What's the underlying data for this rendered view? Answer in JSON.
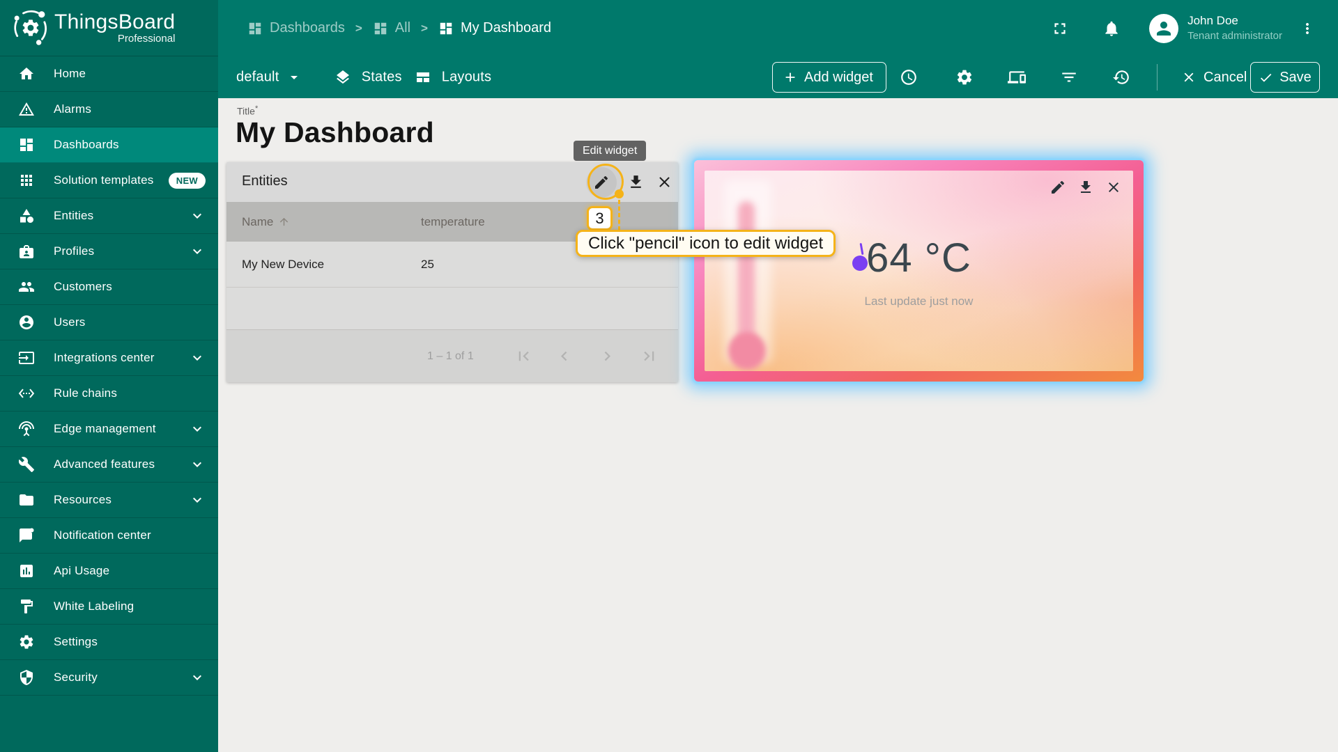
{
  "app": {
    "name": "ThingsBoard",
    "edition": "Professional"
  },
  "sidebar": {
    "items": [
      {
        "label": "Home",
        "icon": "home"
      },
      {
        "label": "Alarms",
        "icon": "warning"
      },
      {
        "label": "Dashboards",
        "icon": "dashboard",
        "selected": true
      },
      {
        "label": "Solution templates",
        "icon": "apps",
        "badge": "NEW"
      },
      {
        "label": "Entities",
        "icon": "category",
        "expandable": true
      },
      {
        "label": "Profiles",
        "icon": "badge",
        "expandable": true
      },
      {
        "label": "Customers",
        "icon": "people"
      },
      {
        "label": "Users",
        "icon": "account-circle"
      },
      {
        "label": "Integrations center",
        "icon": "input",
        "expandable": true
      },
      {
        "label": "Rule chains",
        "icon": "settings-ethernet"
      },
      {
        "label": "Edge management",
        "icon": "antenna",
        "expandable": true
      },
      {
        "label": "Advanced features",
        "icon": "tools",
        "expandable": true
      },
      {
        "label": "Resources",
        "icon": "folder",
        "expandable": true
      },
      {
        "label": "Notification center",
        "icon": "notification-bubble"
      },
      {
        "label": "Api Usage",
        "icon": "chart-box"
      },
      {
        "label": "White Labeling",
        "icon": "paint"
      },
      {
        "label": "Settings",
        "icon": "gear"
      },
      {
        "label": "Security",
        "icon": "shield",
        "expandable": true
      }
    ]
  },
  "header": {
    "breadcrumb": [
      {
        "label": "Dashboards"
      },
      {
        "label": "All"
      },
      {
        "label": "My Dashboard"
      }
    ],
    "separator": ">",
    "user": {
      "name": "John Doe",
      "role": "Tenant administrator"
    }
  },
  "toolbar": {
    "state_selector": "default",
    "states_label": "States",
    "layouts_label": "Layouts",
    "add_widget_label": "Add widget",
    "cancel_label": "Cancel",
    "save_label": "Save"
  },
  "page": {
    "title_label": "Title",
    "required_marker": "*",
    "title": "My Dashboard"
  },
  "entities_widget": {
    "title": "Entities",
    "table": {
      "columns": [
        "Name",
        "temperature"
      ],
      "rows": [
        {
          "name": "My New Device",
          "temperature": "25"
        }
      ]
    },
    "pagination": "1 – 1 of 1"
  },
  "temperature_widget": {
    "value": "64 °C",
    "last_update": "Last update just now"
  },
  "tutorial": {
    "tooltip": "Edit widget",
    "step": "3",
    "instruction": "Click \"pencil\" icon to edit widget"
  },
  "colors": {
    "sidebar": "#00695C",
    "topbar": "#00796B",
    "selected_item": "#00897B",
    "tutorial_accent": "#F5B319",
    "selection_glow": "#6EC8FF",
    "temp_value_text": "#3B474E"
  }
}
